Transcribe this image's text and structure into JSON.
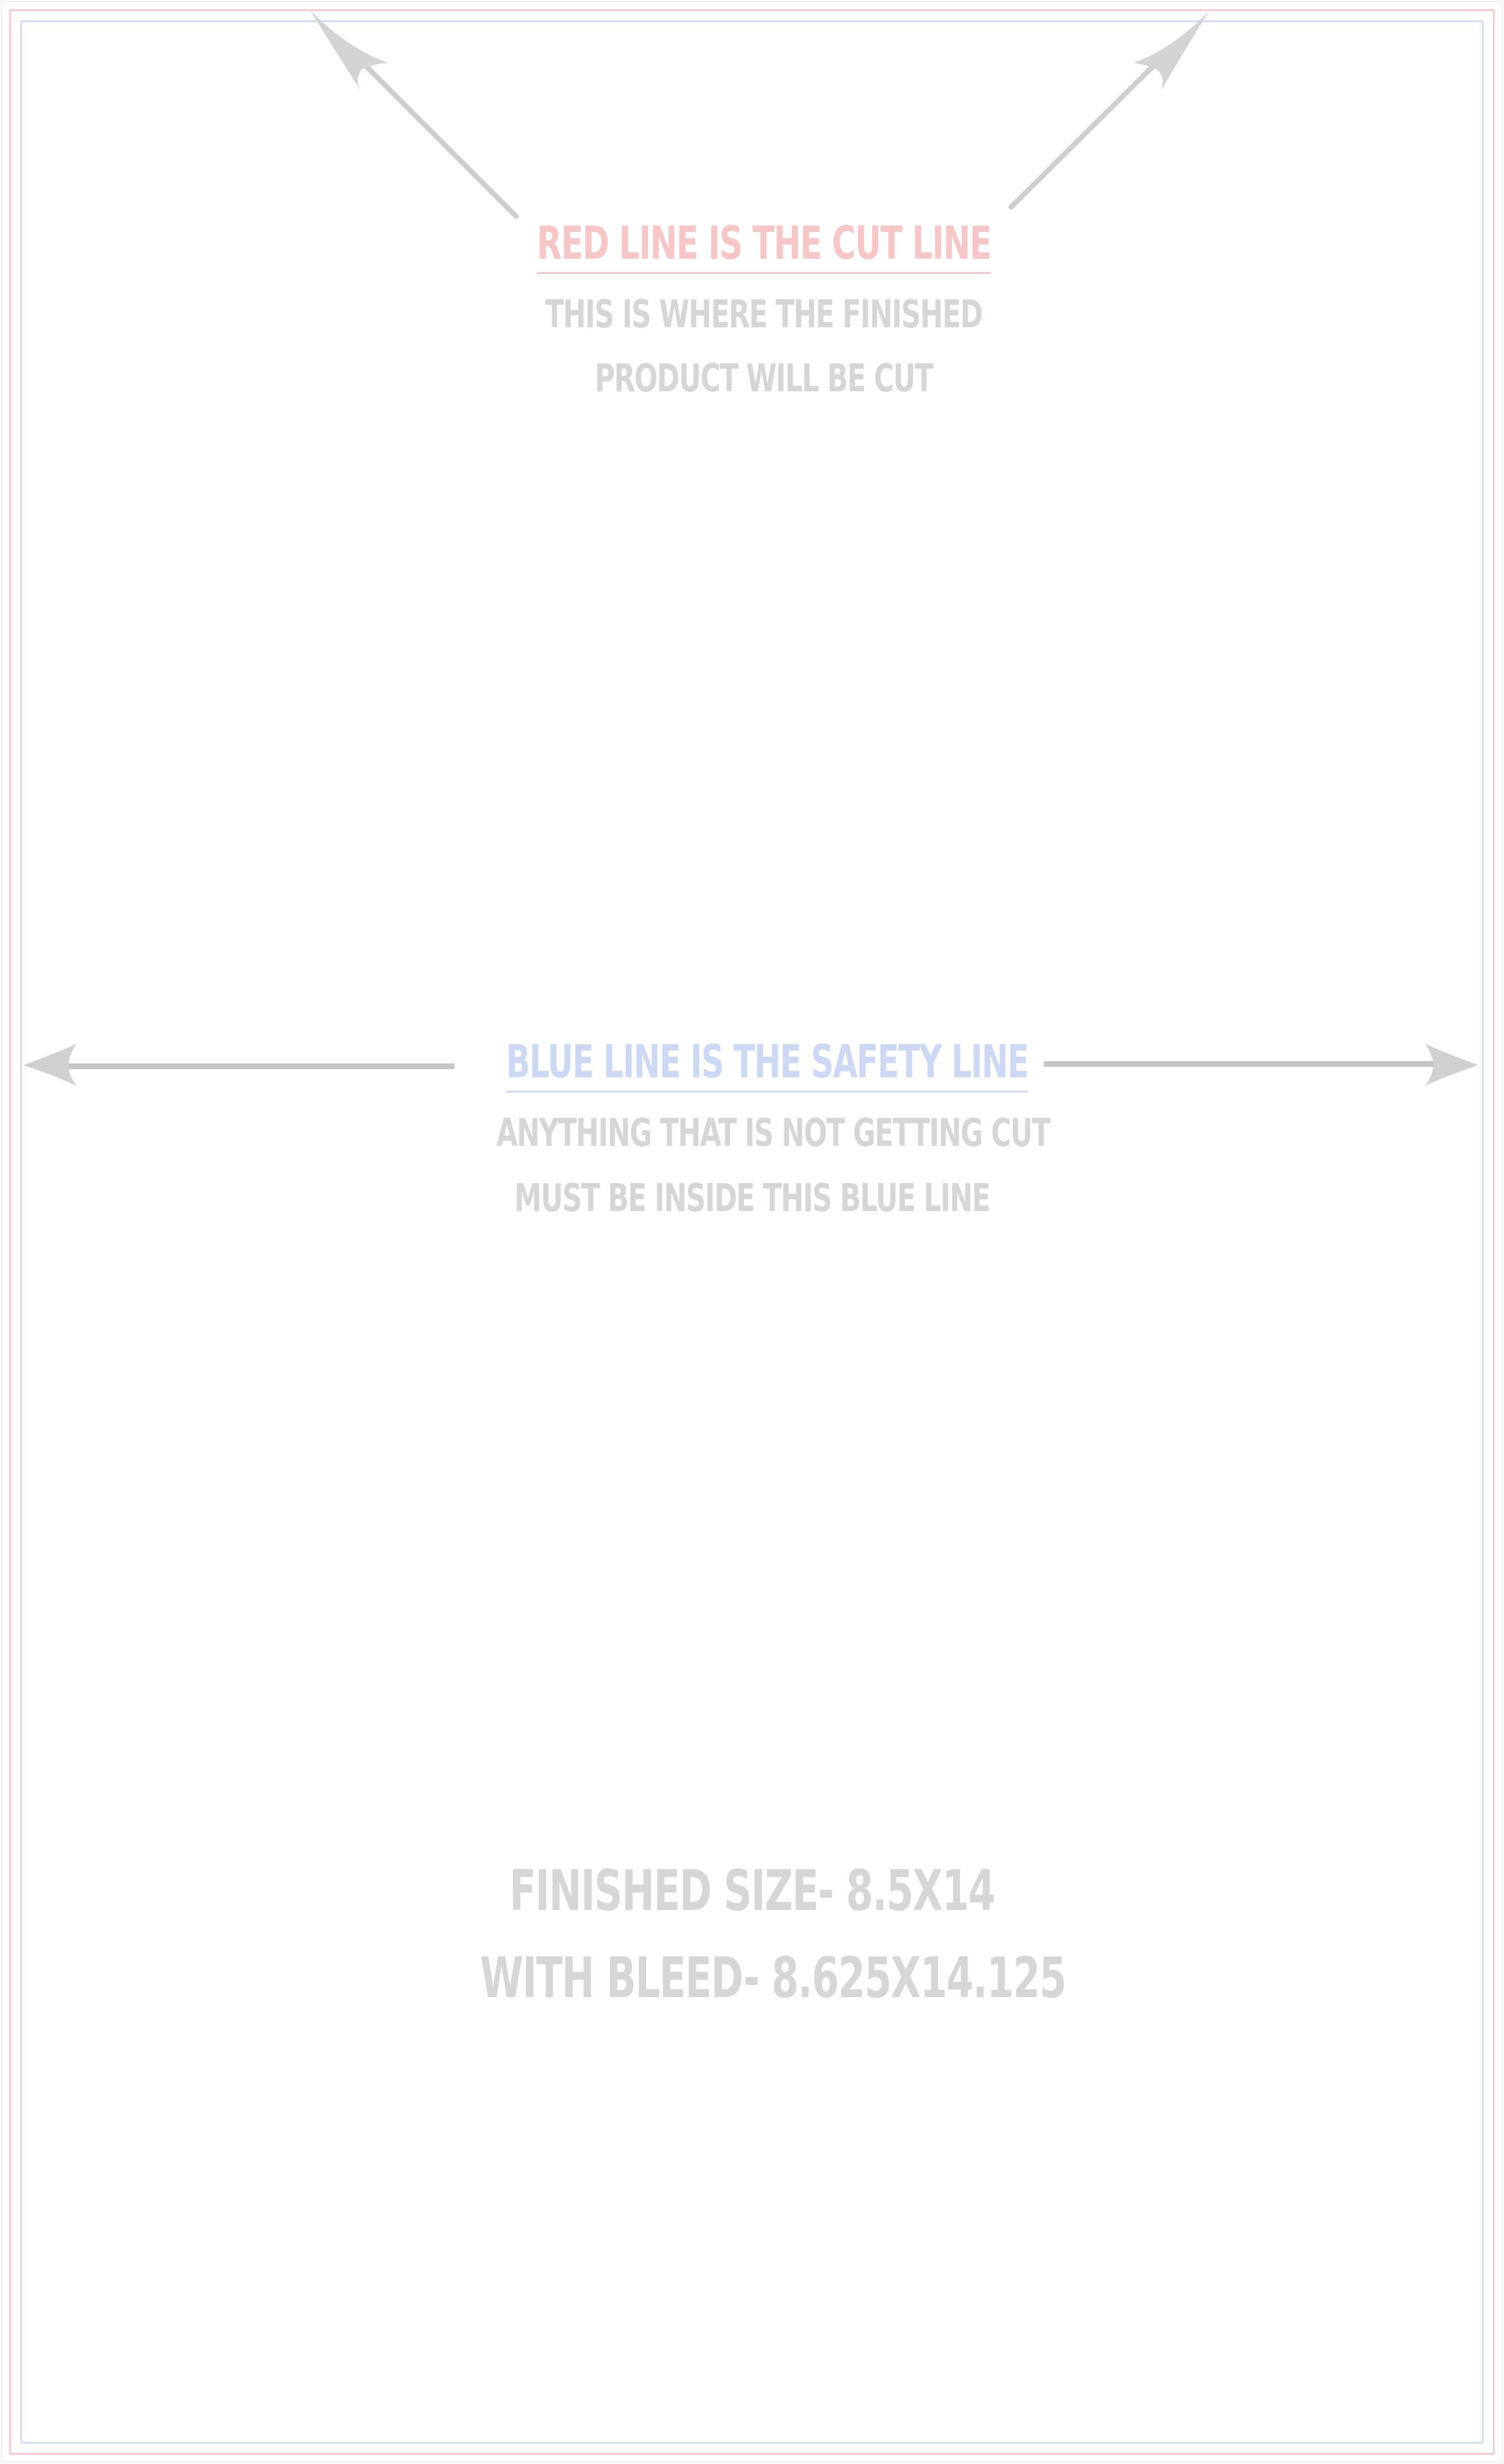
{
  "cut_section": {
    "heading": "RED LINE IS THE CUT LINE",
    "line1": "THIS IS WHERE THE FINISHED",
    "line2": "PRODUCT WILL BE CUT"
  },
  "safety_section": {
    "heading": "BLUE LINE IS THE SAFETY LINE",
    "line1": "ANYTHING THAT IS NOT GETTING CUT",
    "line2": "MUST BE INSIDE THIS BLUE LINE"
  },
  "size_info": {
    "finished": "FINISHED SIZE- 8.5X14",
    "bleed": "WITH BLEED- 8.625X14.125"
  },
  "colors": {
    "cut_line": "#f6c9cc",
    "safety_line": "#cfdcf6",
    "text_gray": "#d6d6d6",
    "arrow_gray": "#cfcfcf"
  }
}
